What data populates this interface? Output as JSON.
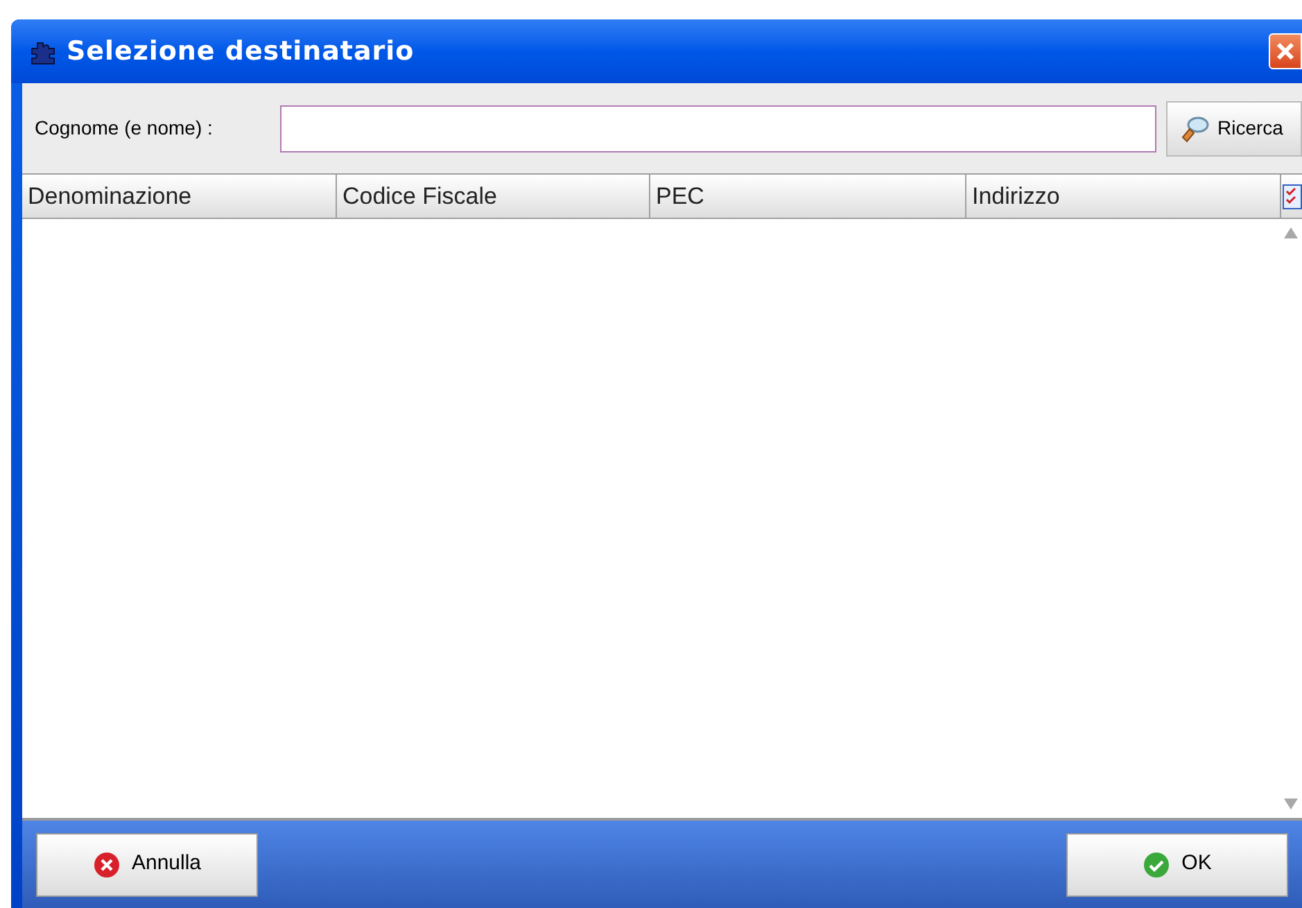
{
  "window": {
    "title": "Selezione destinatario"
  },
  "search": {
    "label": "Cognome (e nome) :",
    "button": "Ricerca"
  },
  "table": {
    "columns": [
      "Denominazione",
      "Codice Fiscale",
      "PEC",
      "Indirizzo"
    ]
  },
  "buttons": [
    {
      "label": "Annulla",
      "kind": "cancel"
    },
    {
      "label": "OK",
      "kind": "ok"
    }
  ]
}
